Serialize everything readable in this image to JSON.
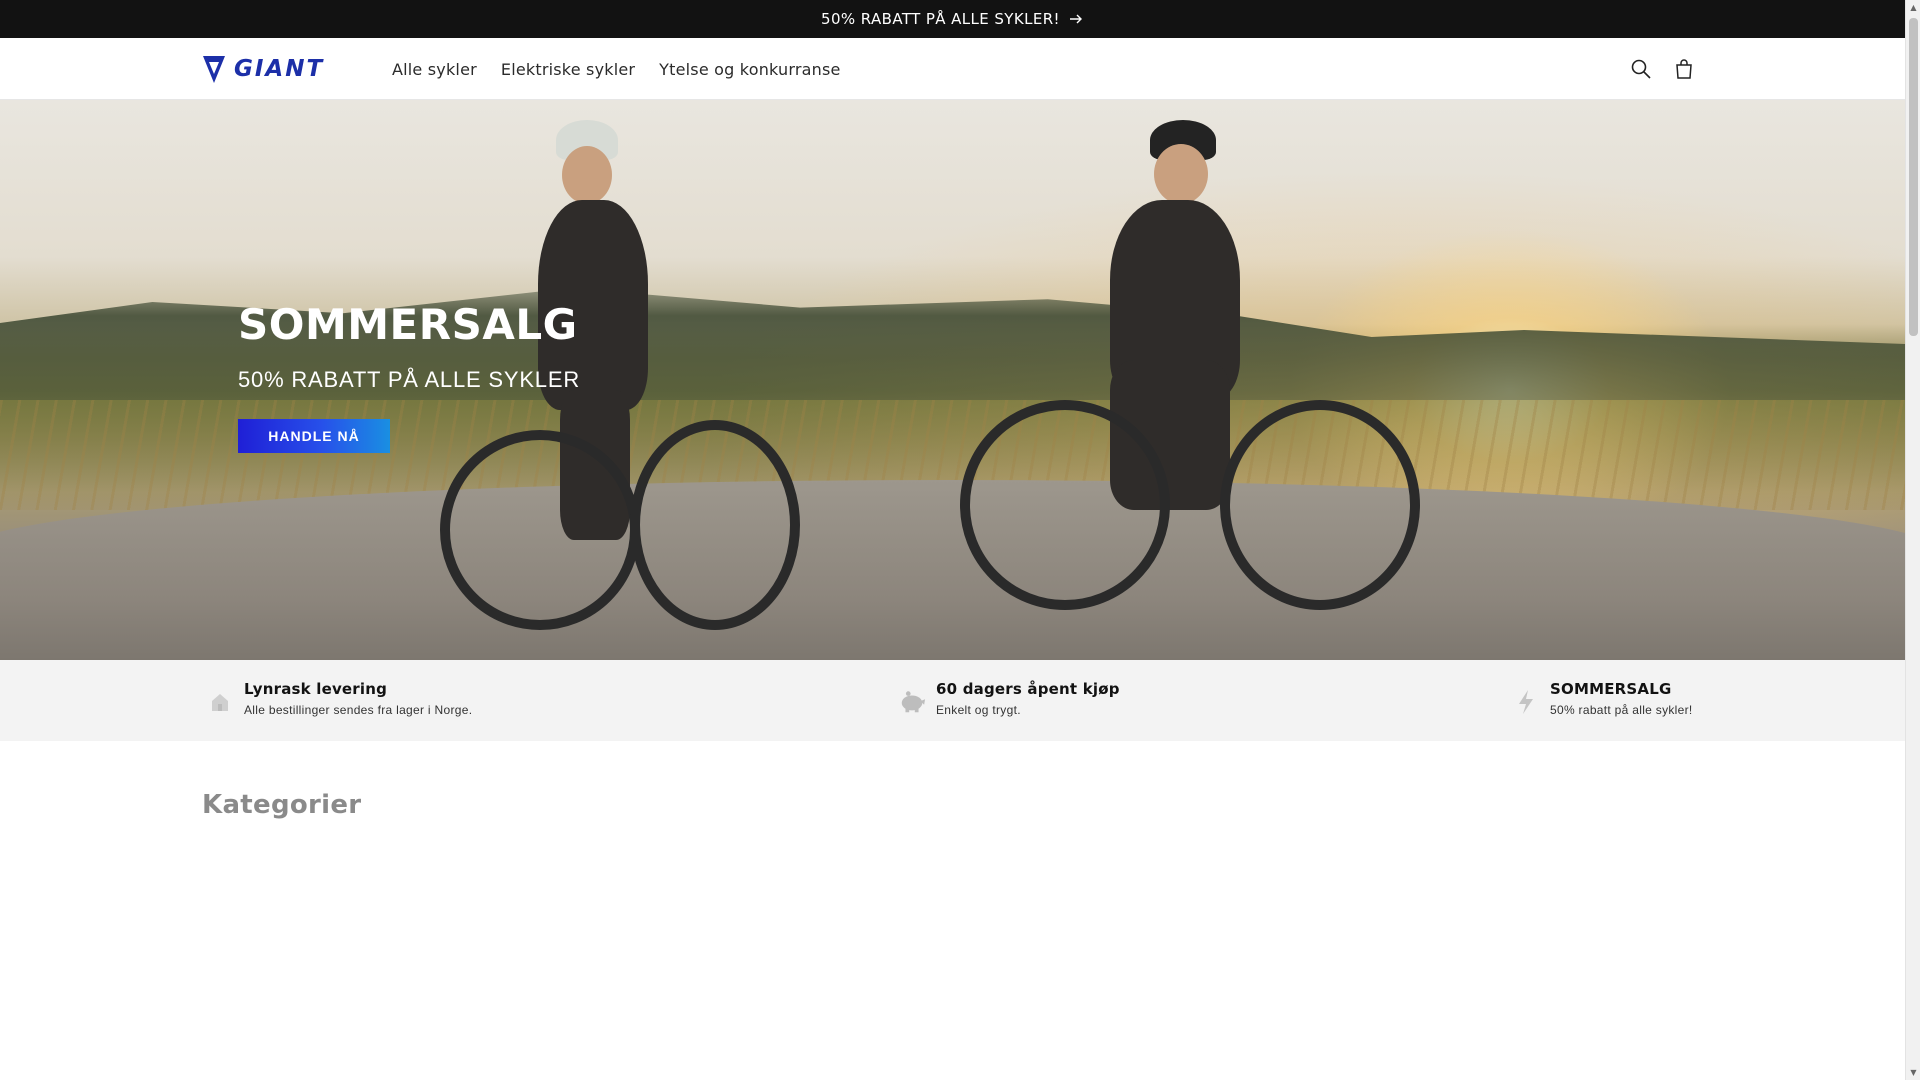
{
  "announcement": {
    "text": "50% RABATT PÅ ALLE SYKLER!",
    "icon": "arrow-right-icon"
  },
  "header": {
    "logo_text": "GIANT",
    "nav": [
      {
        "label": "Alle sykler"
      },
      {
        "label": "Elektriske sykler"
      },
      {
        "label": "Ytelse og konkurranse"
      }
    ],
    "search_icon": "search-icon",
    "cart_icon": "cart-icon"
  },
  "hero": {
    "title": "SOMMERSALG",
    "subtitle": "50% RABATT PÅ ALLE SYKLER",
    "button_label": "HANDLE NÅ"
  },
  "features": [
    {
      "icon": "house-icon",
      "title": "Lynrask levering",
      "text": "Alle bestillinger sendes fra lager i Norge."
    },
    {
      "icon": "piggy-bank-icon",
      "title": "60 dagers åpent kjøp",
      "text": "Enkelt og trygt."
    },
    {
      "icon": "lightning-icon",
      "title": "SOMMERSALG",
      "text": "50% rabatt på alle sykler!"
    }
  ],
  "categories": {
    "title": "Kategorier"
  },
  "colors": {
    "announcement_bg": "#121212",
    "button_gradient_start": "#1f1fd6",
    "button_gradient_end": "#1a8fe2",
    "logo_blue": "#1c2fa8",
    "feature_bg": "#f3f3f3"
  }
}
